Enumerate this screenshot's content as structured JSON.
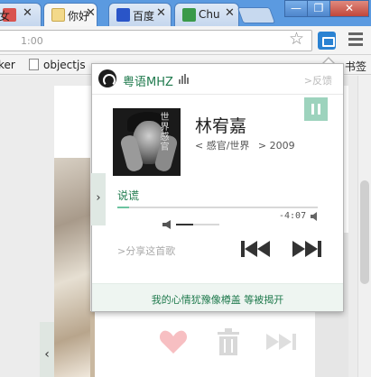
{
  "browser": {
    "tabs": [
      {
        "label": "美女",
        "favicon_color": "#d9534f",
        "active": false
      },
      {
        "label": "你好",
        "favicon_color": "#e8c36a",
        "active": true
      },
      {
        "label": "百度",
        "favicon_color": "#2a55c8",
        "active": false
      },
      {
        "label": "Chu",
        "favicon_color": "#3a9a4a",
        "active": false
      }
    ],
    "window_buttons": {
      "minimize": "—",
      "restore": "❐",
      "close": "✕"
    },
    "address": "1:00",
    "bookmarks": [
      {
        "label": "ker"
      },
      {
        "label": "objectjs"
      },
      {
        "label": "书签"
      }
    ]
  },
  "popup": {
    "brand": "粤语MHZ",
    "feedback": ">反馈",
    "artist": "林宥嘉",
    "album": "< 感官/世界",
    "year": "> 2009",
    "cover_text": "世界感官",
    "song_title": "说谎",
    "time": "-4:07",
    "progress_fraction": 0.06,
    "volume_fraction": 0.4,
    "share": ">分享这首歌",
    "lyric": "我的心情犹豫像樽盖  等被揭开",
    "side_arrow": "›"
  },
  "page": {
    "left_arrow": "‹"
  },
  "colors": {
    "accent": "#1f7a4d",
    "accent_light": "#9dd3bd",
    "footer_bg": "#eef5f1"
  }
}
